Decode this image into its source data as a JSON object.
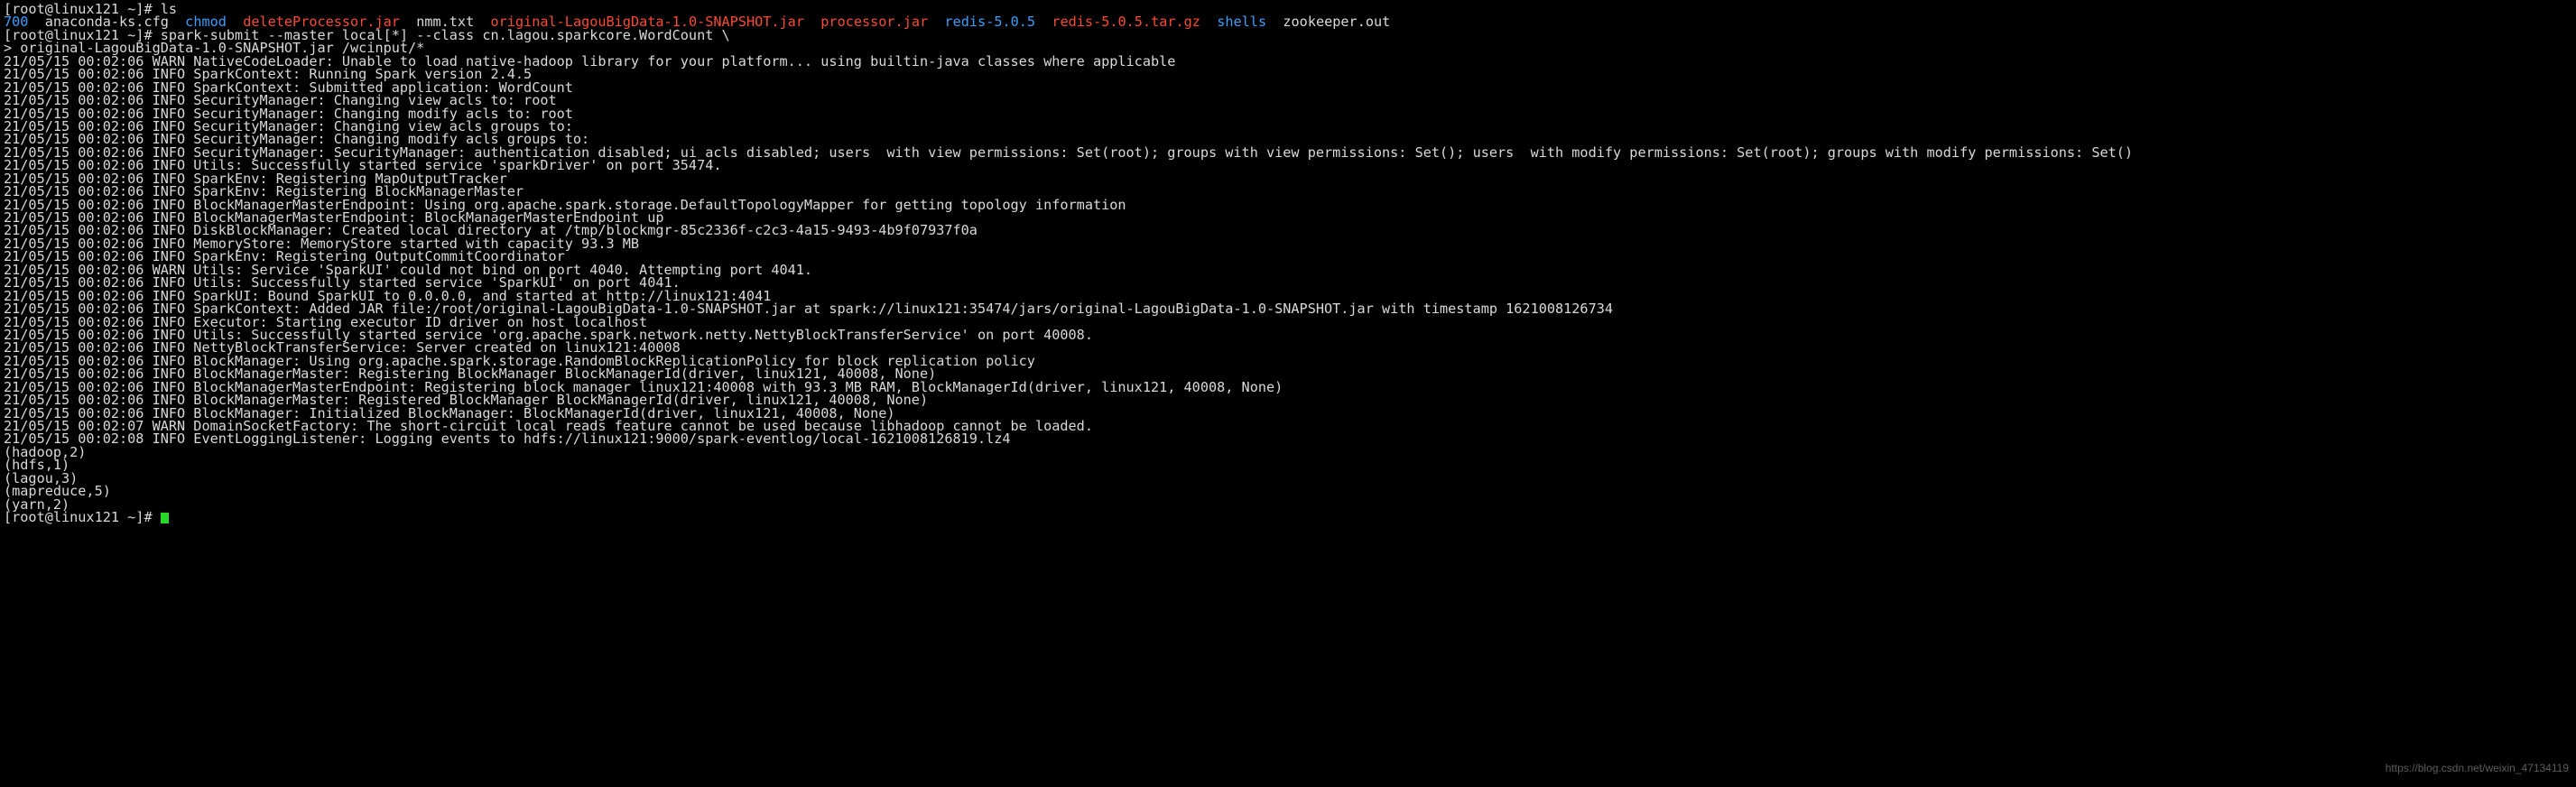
{
  "terminal": {
    "title": "root@linux121:~",
    "colors": {
      "background": "#000000",
      "foreground": "#d9d9d9",
      "blue": "#3b9eff",
      "red": "#fb4934",
      "green": "#26d826",
      "watermark": "#5d5d5d"
    },
    "prompt": "[root@linux121 ~]# ",
    "continuation_prompt": "> ",
    "cursor": "block-cursor",
    "lines": [
      {
        "segments": [
          {
            "text": "[root@linux121 ~]# ls",
            "color": "white"
          }
        ]
      },
      {
        "segments": [
          {
            "text": "700",
            "color": "blue"
          },
          {
            "text": "  anaconda-ks.cfg  ",
            "color": "white"
          },
          {
            "text": "chmod",
            "color": "blue"
          },
          {
            "text": "  ",
            "color": "white"
          },
          {
            "text": "deleteProcessor.jar",
            "color": "red"
          },
          {
            "text": "  nmm.txt  ",
            "color": "white"
          },
          {
            "text": "original-LagouBigData-1.0-SNAPSHOT.jar",
            "color": "red"
          },
          {
            "text": "  ",
            "color": "white"
          },
          {
            "text": "processor.jar",
            "color": "red"
          },
          {
            "text": "  ",
            "color": "white"
          },
          {
            "text": "redis-5.0.5",
            "color": "blue"
          },
          {
            "text": "  ",
            "color": "white"
          },
          {
            "text": "redis-5.0.5.tar.gz",
            "color": "red"
          },
          {
            "text": "  ",
            "color": "white"
          },
          {
            "text": "shells",
            "color": "blue"
          },
          {
            "text": "  zookeeper.out",
            "color": "white"
          }
        ]
      },
      {
        "segments": [
          {
            "text": "[root@linux121 ~]# spark-submit --master local[*] --class cn.lagou.sparkcore.WordCount \\",
            "color": "white"
          }
        ]
      },
      {
        "segments": [
          {
            "text": "> original-LagouBigData-1.0-SNAPSHOT.jar /wcinput/*",
            "color": "white"
          }
        ]
      },
      {
        "segments": [
          {
            "text": "21/05/15 00:02:06 WARN NativeCodeLoader: Unable to load native-hadoop library for your platform... using builtin-java classes where applicable",
            "color": "white"
          }
        ]
      },
      {
        "segments": [
          {
            "text": "21/05/15 00:02:06 INFO SparkContext: Running Spark version 2.4.5",
            "color": "white"
          }
        ]
      },
      {
        "segments": [
          {
            "text": "21/05/15 00:02:06 INFO SparkContext: Submitted application: WordCount",
            "color": "white"
          }
        ]
      },
      {
        "segments": [
          {
            "text": "21/05/15 00:02:06 INFO SecurityManager: Changing view acls to: root",
            "color": "white"
          }
        ]
      },
      {
        "segments": [
          {
            "text": "21/05/15 00:02:06 INFO SecurityManager: Changing modify acls to: root",
            "color": "white"
          }
        ]
      },
      {
        "segments": [
          {
            "text": "21/05/15 00:02:06 INFO SecurityManager: Changing view acls groups to:",
            "color": "white"
          }
        ]
      },
      {
        "segments": [
          {
            "text": "21/05/15 00:02:06 INFO SecurityManager: Changing modify acls groups to:",
            "color": "white"
          }
        ]
      },
      {
        "segments": [
          {
            "text": "21/05/15 00:02:06 INFO SecurityManager: SecurityManager: authentication disabled; ui acls disabled; users  with view permissions: Set(root); groups with view permissions: Set(); users  with modify permissions: Set(root); groups with modify permissions: Set()",
            "color": "white"
          }
        ]
      },
      {
        "segments": [
          {
            "text": "21/05/15 00:02:06 INFO Utils: Successfully started service 'sparkDriver' on port 35474.",
            "color": "white"
          }
        ]
      },
      {
        "segments": [
          {
            "text": "21/05/15 00:02:06 INFO SparkEnv: Registering MapOutputTracker",
            "color": "white"
          }
        ]
      },
      {
        "segments": [
          {
            "text": "21/05/15 00:02:06 INFO SparkEnv: Registering BlockManagerMaster",
            "color": "white"
          }
        ]
      },
      {
        "segments": [
          {
            "text": "21/05/15 00:02:06 INFO BlockManagerMasterEndpoint: Using org.apache.spark.storage.DefaultTopologyMapper for getting topology information",
            "color": "white"
          }
        ]
      },
      {
        "segments": [
          {
            "text": "21/05/15 00:02:06 INFO BlockManagerMasterEndpoint: BlockManagerMasterEndpoint up",
            "color": "white"
          }
        ]
      },
      {
        "segments": [
          {
            "text": "21/05/15 00:02:06 INFO DiskBlockManager: Created local directory at /tmp/blockmgr-85c2336f-c2c3-4a15-9493-4b9f07937f0a",
            "color": "white"
          }
        ]
      },
      {
        "segments": [
          {
            "text": "21/05/15 00:02:06 INFO MemoryStore: MemoryStore started with capacity 93.3 MB",
            "color": "white"
          }
        ]
      },
      {
        "segments": [
          {
            "text": "21/05/15 00:02:06 INFO SparkEnv: Registering OutputCommitCoordinator",
            "color": "white"
          }
        ]
      },
      {
        "segments": [
          {
            "text": "21/05/15 00:02:06 WARN Utils: Service 'SparkUI' could not bind on port 4040. Attempting port 4041.",
            "color": "white"
          }
        ]
      },
      {
        "segments": [
          {
            "text": "21/05/15 00:02:06 INFO Utils: Successfully started service 'SparkUI' on port 4041.",
            "color": "white"
          }
        ]
      },
      {
        "segments": [
          {
            "text": "21/05/15 00:02:06 INFO SparkUI: Bound SparkUI to 0.0.0.0, and started at http://linux121:4041",
            "color": "white"
          }
        ]
      },
      {
        "segments": [
          {
            "text": "21/05/15 00:02:06 INFO SparkContext: Added JAR file:/root/original-LagouBigData-1.0-SNAPSHOT.jar at spark://linux121:35474/jars/original-LagouBigData-1.0-SNAPSHOT.jar with timestamp 1621008126734",
            "color": "white"
          }
        ]
      },
      {
        "segments": [
          {
            "text": "21/05/15 00:02:06 INFO Executor: Starting executor ID driver on host localhost",
            "color": "white"
          }
        ]
      },
      {
        "segments": [
          {
            "text": "21/05/15 00:02:06 INFO Utils: Successfully started service 'org.apache.spark.network.netty.NettyBlockTransferService' on port 40008.",
            "color": "white"
          }
        ]
      },
      {
        "segments": [
          {
            "text": "21/05/15 00:02:06 INFO NettyBlockTransferService: Server created on linux121:40008",
            "color": "white"
          }
        ]
      },
      {
        "segments": [
          {
            "text": "21/05/15 00:02:06 INFO BlockManager: Using org.apache.spark.storage.RandomBlockReplicationPolicy for block replication policy",
            "color": "white"
          }
        ]
      },
      {
        "segments": [
          {
            "text": "21/05/15 00:02:06 INFO BlockManagerMaster: Registering BlockManager BlockManagerId(driver, linux121, 40008, None)",
            "color": "white"
          }
        ]
      },
      {
        "segments": [
          {
            "text": "21/05/15 00:02:06 INFO BlockManagerMasterEndpoint: Registering block manager linux121:40008 with 93.3 MB RAM, BlockManagerId(driver, linux121, 40008, None)",
            "color": "white"
          }
        ]
      },
      {
        "segments": [
          {
            "text": "21/05/15 00:02:06 INFO BlockManagerMaster: Registered BlockManager BlockManagerId(driver, linux121, 40008, None)",
            "color": "white"
          }
        ]
      },
      {
        "segments": [
          {
            "text": "21/05/15 00:02:06 INFO BlockManager: Initialized BlockManager: BlockManagerId(driver, linux121, 40008, None)",
            "color": "white"
          }
        ]
      },
      {
        "segments": [
          {
            "text": "21/05/15 00:02:07 WARN DomainSocketFactory: The short-circuit local reads feature cannot be used because libhadoop cannot be loaded.",
            "color": "white"
          }
        ]
      },
      {
        "segments": [
          {
            "text": "21/05/15 00:02:08 INFO EventLoggingListener: Logging events to hdfs://linux121:9000/spark-eventlog/local-1621008126819.lz4",
            "color": "white"
          }
        ]
      },
      {
        "segments": [
          {
            "text": "(hadoop,2)",
            "color": "white"
          }
        ]
      },
      {
        "segments": [
          {
            "text": "(hdfs,1)",
            "color": "white"
          }
        ]
      },
      {
        "segments": [
          {
            "text": "(lagou,3)",
            "color": "white"
          }
        ]
      },
      {
        "segments": [
          {
            "text": "(mapreduce,5)",
            "color": "white"
          }
        ]
      },
      {
        "segments": [
          {
            "text": "(yarn,2)",
            "color": "white"
          }
        ]
      },
      {
        "segments": [
          {
            "text": "[root@linux121 ~]# ",
            "color": "white"
          },
          {
            "text": "",
            "color": "green",
            "cursor": true
          }
        ]
      }
    ]
  },
  "watermark": {
    "text": "https://blog.csdn.net/weixin_47134119"
  }
}
